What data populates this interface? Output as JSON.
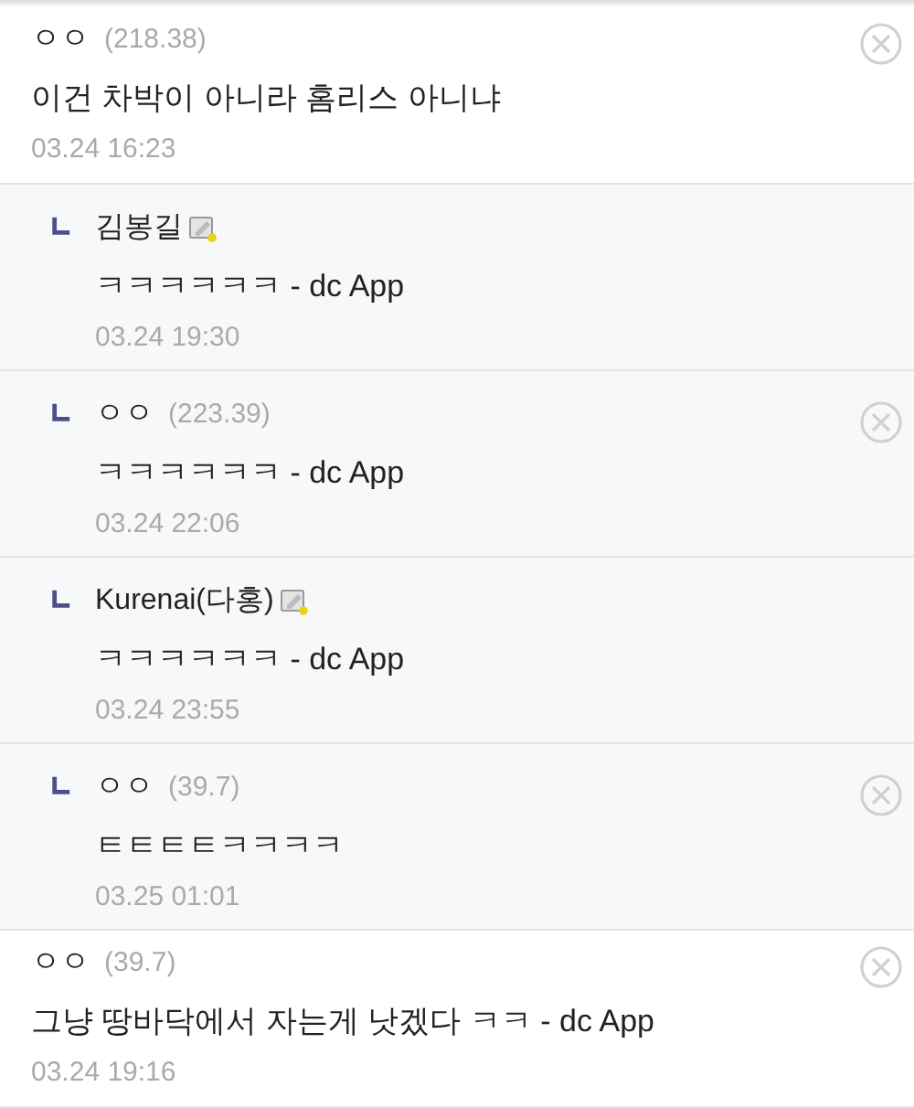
{
  "comments": [
    {
      "author": "ㅇㅇ",
      "ip": "(218.38)",
      "member": false,
      "deletable": true,
      "text": "이건 차박이 아니라 홈리스 아니냐",
      "time": "03.24 16:23",
      "children": [
        {
          "author": "김봉길",
          "member": true,
          "deletable": false,
          "text": "ㅋㅋㅋㅋㅋㅋ - dc App",
          "time": "03.24 19:30"
        },
        {
          "author": "ㅇㅇ",
          "ip": "(223.39)",
          "member": false,
          "deletable": true,
          "text": "ㅋㅋㅋㅋㅋㅋ - dc App",
          "time": "03.24 22:06"
        },
        {
          "author": "Kurenai(다홍)",
          "member": true,
          "deletable": false,
          "text": "ㅋㅋㅋㅋㅋㅋ - dc App",
          "time": "03.24 23:55"
        },
        {
          "author": "ㅇㅇ",
          "ip": "(39.7)",
          "member": false,
          "deletable": true,
          "text": "ㅌㅌㅌㅌㅋㅋㅋㅋ",
          "time": "03.25 01:01"
        }
      ]
    },
    {
      "author": "ㅇㅇ",
      "ip": "(39.7)",
      "member": false,
      "deletable": true,
      "text": "그냥 땅바닥에서 자는게 낫겠다 ㅋㅋ - dc App",
      "time": "03.24 19:16"
    }
  ]
}
